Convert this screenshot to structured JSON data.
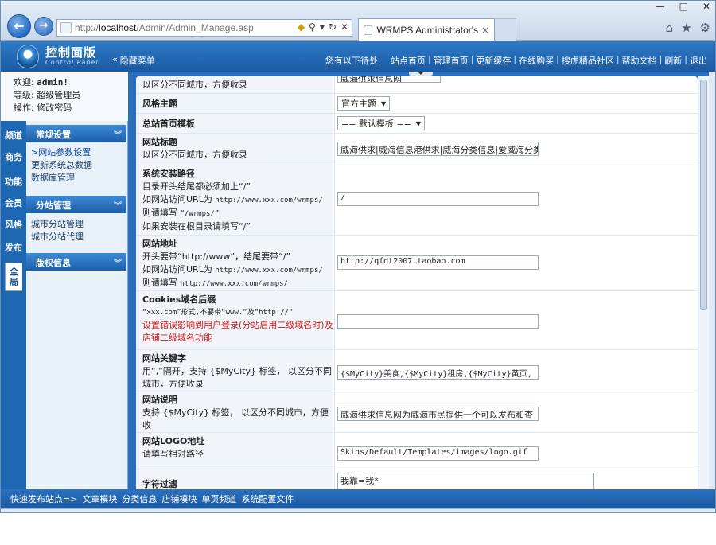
{
  "browser": {
    "address_prefix": "http://",
    "address_host": "localhost",
    "address_path": "/Admin/Admin_Manage.asp",
    "tab_title": "WRMPS Administrator's Co...",
    "tab_close": "×",
    "win_min": "—",
    "win_max": "□",
    "win_close": "✕"
  },
  "header": {
    "title": "控制面版",
    "subtitle": "Control Panel",
    "hide_menu": "隐藏菜单",
    "greeting": "您有以下待处",
    "nav": [
      "站点首页",
      "管理首页",
      "更新缓存",
      "在线购买",
      "搜虎精品社区",
      "帮助文档",
      "刷新",
      "退出"
    ]
  },
  "user": {
    "welcome_label": "欢迎:",
    "username": "admin!",
    "level_label": "等级:",
    "level_value": "超级管理员",
    "action_label": "操作:",
    "action_value": "修改密码"
  },
  "vtabs": [
    "频道",
    "商务",
    "功能",
    "会员",
    "风格",
    "发布",
    "全局"
  ],
  "groups": [
    {
      "title": "常规设置",
      "links": [
        "网站参数设置",
        "更新系统总数据",
        "数据库管理"
      ]
    },
    {
      "title": "分站管理",
      "links": [
        "城市分站管理",
        "城市分站代理"
      ]
    },
    {
      "title": "版权信息",
      "links": []
    }
  ],
  "form": {
    "row0": {
      "desc": "以区分不同城市，方便收录",
      "value": "威海供求信息网"
    },
    "row1": {
      "title": "风格主题",
      "value": "官方主题"
    },
    "row2": {
      "title": "总站首页模板",
      "value": "== 默认模板 =="
    },
    "row3": {
      "title": "网站标题",
      "desc": "以区分不同城市，方便收录",
      "value": "威海供求|威海信息港供求|威海分类信息|爱威海分类"
    },
    "row4": {
      "title": "系统安装路径",
      "d1": "目录开头结尾都必须加上“/”",
      "d2": "如网站访问URL为",
      "d2m": "http://www.xxx.com/wrmps/",
      "d3": "则请填写",
      "d3m": "“/wrmps/”",
      "d4": "如果安装在根目录请填写“/”",
      "value": "/"
    },
    "row5": {
      "title": "网站地址",
      "d1": "开头要带“http://www”，结尾要带“/”",
      "d2": "如网站访问URL为",
      "d2m": "http://www.xxx.com/wrmps/",
      "d3": "则请填写",
      "d3m": "http://www.xxx.com/wrmps/",
      "value": "http://qfdt2007.taobao.com"
    },
    "row6": {
      "title": "Cookies域名后缀",
      "d1": "“xxx.com”形式,不要带“www.”及“http://”",
      "red1": "设置错误影响到用户登录(分站启用二级域名时)及",
      "red2": "店铺二级域名功能",
      "value": ""
    },
    "row7": {
      "title": "网站关键字",
      "d1": "用“,”隔开，支持 {$MyCity} 标签， 以区分不同",
      "d2": "城市，方便收录",
      "value": "{$MyCity}美食,{$MyCity}租房,{$MyCity}黄页,"
    },
    "row8": {
      "title": "网站说明",
      "d1": "支持 {$MyCity} 标签， 以区分不同城市，方便收",
      "d2": "录",
      "value": "威海供求信息网为威海市民提供一个可以发布和查"
    },
    "row9": {
      "title": "网站LOGO地址",
      "desc": "请填写相对路径",
      "value": "Skins/Default/Templates/images/logo.gif"
    },
    "row10": {
      "title": "字符过滤",
      "value": "我靠=我*"
    }
  },
  "bottom": {
    "prefix": "快速发布站点=>",
    "links": [
      "文章模块",
      "分类信息",
      "店铺模块",
      "单页频道",
      "系统配置文件"
    ]
  }
}
